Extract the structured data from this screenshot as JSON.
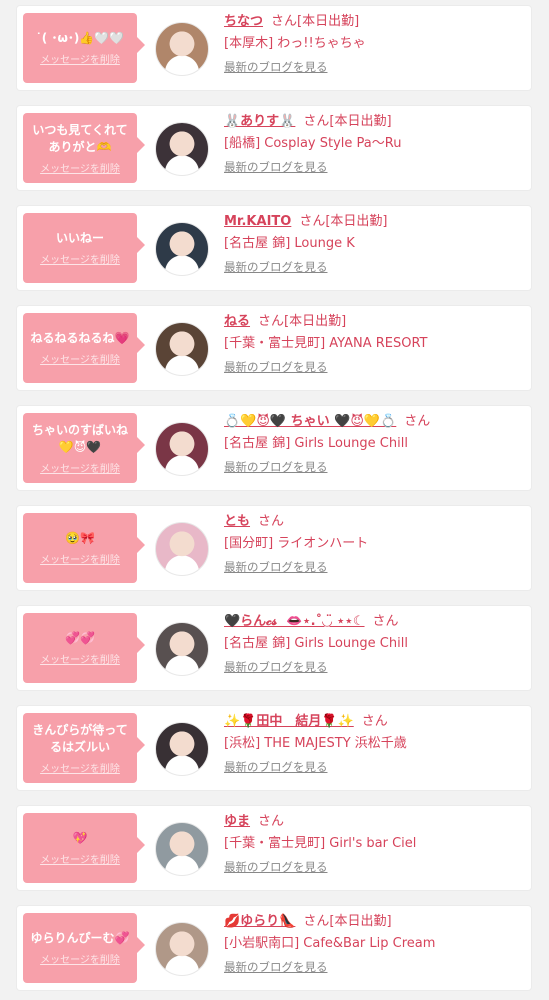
{
  "delete_label": "メッセージを削除",
  "blog_label": "最新のブログを見る",
  "san_label": "さん",
  "avatar_colors": [
    "#b0866a",
    "#3c3238",
    "#2e3a48",
    "#5a4436",
    "#7a3646",
    "#e8b8c8",
    "#585050",
    "#383034",
    "#909aa0",
    "#b09888"
  ],
  "items": [
    {
      "message": "˙( ･ω･)👍🤍🤍",
      "name": "ちなつ",
      "badge": "[本日出勤]",
      "shop": "[本厚木] わっ!!ちゃちゃ"
    },
    {
      "message": "いつも見てくれてありがと🫶",
      "name": "🐰ありす🐰",
      "badge": "[本日出勤]",
      "shop": "[船橋] Cosplay Style Pa〜Ru"
    },
    {
      "message": "いいねー",
      "name": "Mr.KAITO",
      "badge": "[本日出勤]",
      "shop": "[名古屋 錦] Lounge K"
    },
    {
      "message": "ねるねるねるね💗",
      "name": "ねる",
      "badge": "[本日出勤]",
      "shop": "[千葉・富士見町] AYANA RESORT"
    },
    {
      "message": "ちゃいのすばいね💛😈🖤",
      "name": "💍💛😈🖤 ちゃい 🖤😈💛💍",
      "badge": "",
      "shop": "[名古屋 錦] Girls Lounge Chill"
    },
    {
      "message": "🥹🎀",
      "name": "とも",
      "badge": "",
      "shop": "[国分町] ライオンハート"
    },
    {
      "message": "💞💞",
      "name": "🖤らん𝓬𝓼 ‪‪ 👄⋆.˚◡̈ ⋆⋆☾",
      "badge": "",
      "shop": "[名古屋 錦] Girls Lounge Chill"
    },
    {
      "message": "きんぴらが待ってるはズルい",
      "name": "✨🌹田中　結月🌹✨",
      "badge": "",
      "shop": "[浜松] THE MAJESTY 浜松千歳"
    },
    {
      "message": "💖",
      "name": "ゆま",
      "badge": "",
      "shop": "[千葉・富士見町] Girl's bar Ciel"
    },
    {
      "message": "ゆらりんぴーむ💞",
      "name": "💋ゆらり👠",
      "badge": "[本日出勤]",
      "shop": "[小岩駅南口] Cafe&Bar Lip Cream"
    }
  ]
}
